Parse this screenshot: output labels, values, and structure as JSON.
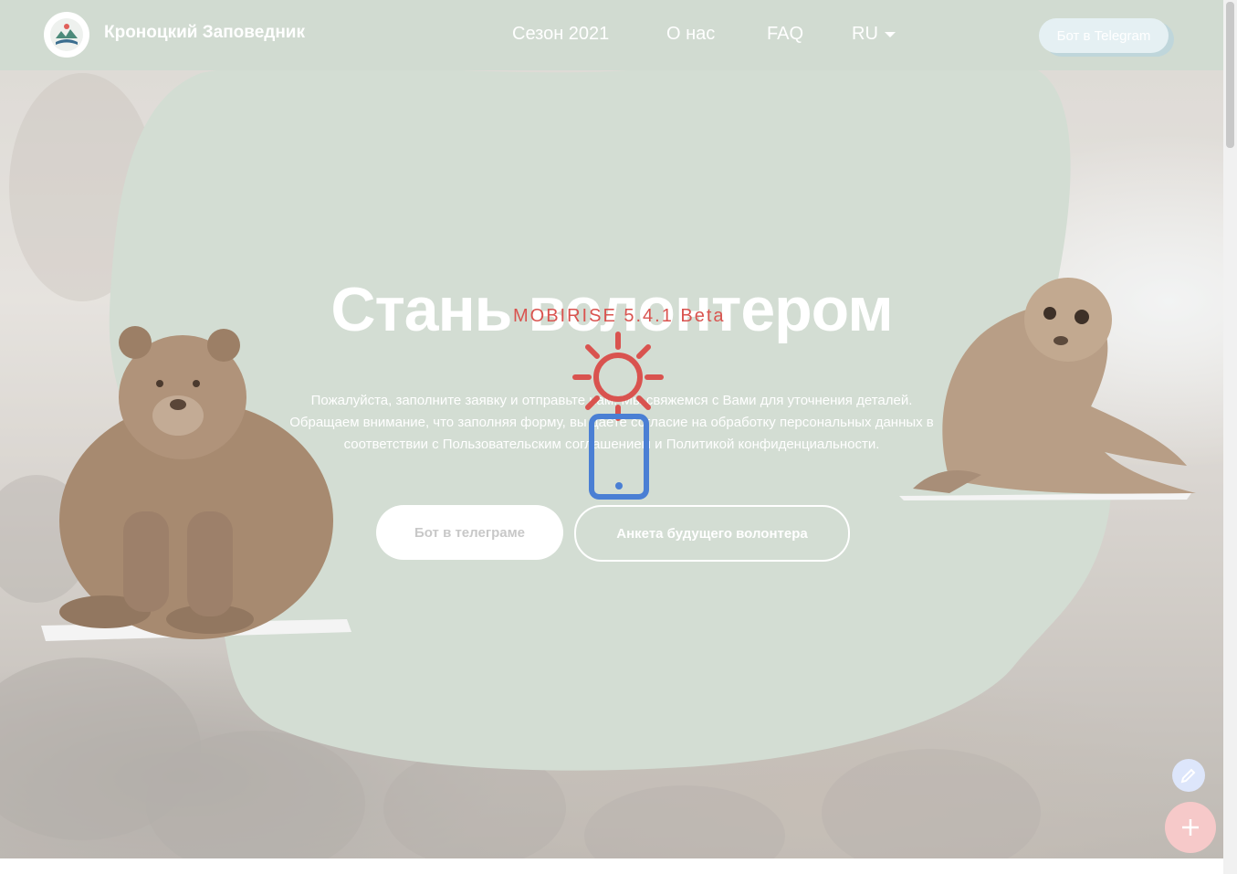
{
  "navbar": {
    "brand": "Кроноцкий Заповедник",
    "items": [
      {
        "label": "Сезон 2021"
      },
      {
        "label": "О нас"
      },
      {
        "label": "FAQ"
      },
      {
        "label": "RU"
      }
    ],
    "cta_label": "Бот в Telegram"
  },
  "hero": {
    "title": "Стань волонтером",
    "text_lines": [
      "Пожалуйста, заполните заявку и отправьте нам. Мы свяжемся с Вами для уточнения деталей.",
      "Обращаем внимание, что заполняя форму, вы даете согласие на обработку персональных данных в",
      "соответствии с Пользовательским соглашением и Политикой конфиденциальности."
    ],
    "primary_button": "Бот в телеграме",
    "secondary_button": "Анкета будущего волонтера"
  },
  "loader": {
    "label": "MOBIRISE 5.4.1 Beta"
  },
  "colors": {
    "navbar_bg": "#d1dbd1",
    "blob": "#d3ddd3",
    "loader_red": "#d9534f",
    "loader_blue": "#4a7fd4"
  },
  "icons": {
    "logo": "reserve-logo-icon",
    "lang_caret": "chevron-down-icon",
    "loader_sun": "sun-icon",
    "loader_phone": "phone-icon",
    "edit": "pencil-icon",
    "add": "plus-icon"
  }
}
